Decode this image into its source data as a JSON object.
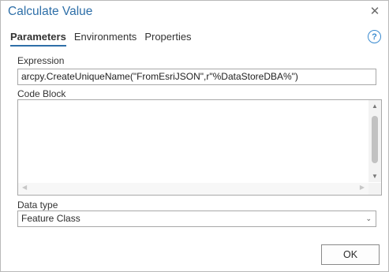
{
  "window": {
    "title": "Calculate Value"
  },
  "tabs": [
    {
      "label": "Parameters",
      "active": true
    },
    {
      "label": "Environments",
      "active": false
    },
    {
      "label": "Properties",
      "active": false
    }
  ],
  "help": {
    "glyph": "?"
  },
  "expression": {
    "label": "Expression",
    "value": "arcpy.CreateUniqueName(\"FromEsriJSON\",r\"%DataStoreDBA%\")"
  },
  "code_block": {
    "label": "Code Block",
    "value": ""
  },
  "data_type": {
    "label": "Data type",
    "selected": "Feature Class"
  },
  "buttons": {
    "ok": "OK"
  },
  "colors": {
    "accent": "#2e6fa8",
    "help": "#3a8bd0"
  }
}
